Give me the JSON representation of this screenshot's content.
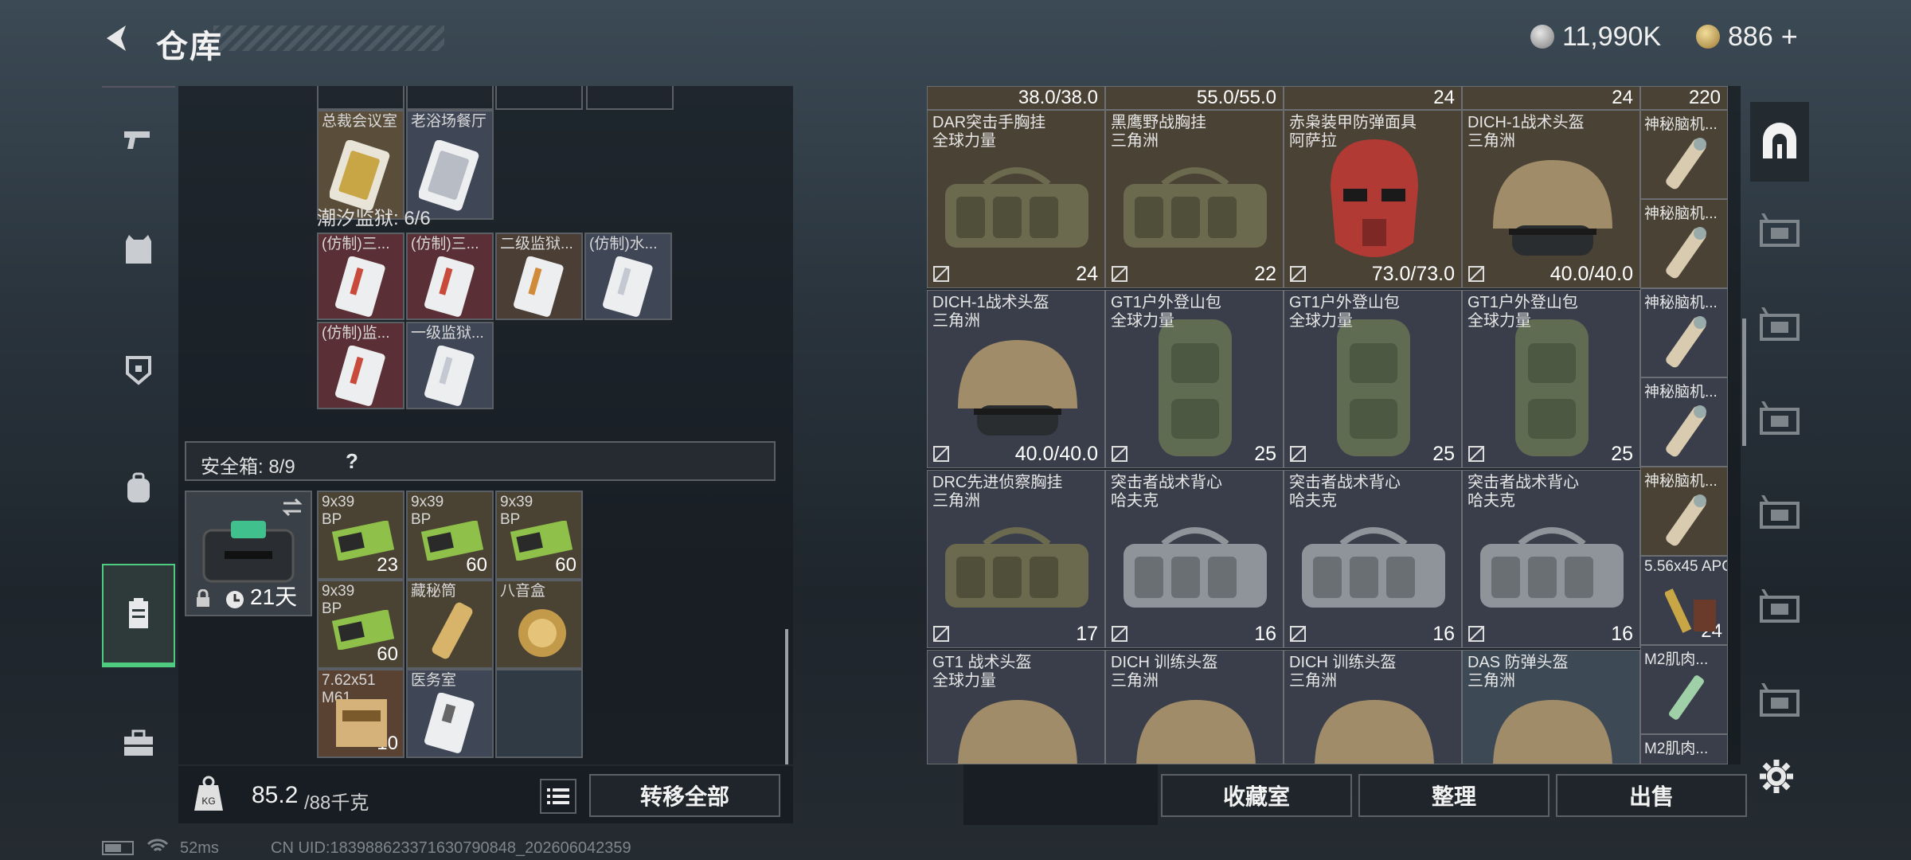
{
  "header": {
    "title": "仓库"
  },
  "currency": [
    {
      "icon": "silver-coin-icon",
      "value": "11,990K"
    },
    {
      "icon": "gold-coin-icon",
      "value": "886"
    }
  ],
  "add_label": "+",
  "rail_tabs": [
    "pistol-icon",
    "vest-icon",
    "backpack-icon",
    "bag-icon",
    "container-icon",
    "briefcase-icon"
  ],
  "left": {
    "top_partial_row": [
      {
        "name": "总裁会议室",
        "tone": "#5a4e3a"
      },
      {
        "name": "老浴场餐厅",
        "tone": "#3f4656"
      }
    ],
    "prison": {
      "label": "潮汐监狱: 6/6",
      "items": [
        {
          "name": "(仿制)三...",
          "tone": "#5a3036"
        },
        {
          "name": "(仿制)三...",
          "tone": "#5a3036"
        },
        {
          "name": "二级监狱...",
          "tone": "#4a3e35"
        },
        {
          "name": "(仿制)水...",
          "tone": "#3f4656"
        },
        {
          "name": "(仿制)监...",
          "tone": "#5a3036"
        },
        {
          "name": "一级监狱...",
          "tone": "#3f4656"
        }
      ]
    },
    "safe_box": {
      "label": "安全箱: 8/9",
      "help": "?",
      "days": "21天",
      "items": [
        {
          "name": "9x39 BP",
          "count": "23",
          "tone": "#4a4232"
        },
        {
          "name": "9x39 BP",
          "count": "60",
          "tone": "#4a4232"
        },
        {
          "name": "9x39 BP",
          "count": "60",
          "tone": "#4a4232"
        },
        {
          "name": "9x39 BP",
          "count": "60",
          "tone": "#4a4232"
        },
        {
          "name": "藏秘筒",
          "count": "",
          "tone": "#4a4232"
        },
        {
          "name": "八音盒",
          "count": "",
          "tone": "#4a4232"
        },
        {
          "name": "7.62x51 M61",
          "count": "10",
          "tone": "#5a4232"
        },
        {
          "name": "医务室",
          "count": "",
          "tone": "#3f4656"
        },
        {
          "name": "",
          "count": "",
          "tone": "#2f3a44"
        }
      ]
    },
    "weight": {
      "current": "85.2",
      "max": "/88千克"
    },
    "transfer_all": "转移全部"
  },
  "grid": {
    "top_partial": [
      "38.0/38.0",
      "55.0/55.0",
      "24",
      "24",
      "220"
    ],
    "cells": [
      {
        "name": "DAR突击手胸挂",
        "src": "全球力量",
        "val": "24",
        "type": "rig",
        "tone": "#4a4234"
      },
      {
        "name": "黑鹰野战胸挂",
        "src": "三角洲",
        "val": "22",
        "type": "rig",
        "tone": "#4a4234"
      },
      {
        "name": "赤枭装甲防弹面具",
        "src": "阿萨拉",
        "val": "73.0/73.0",
        "type": "mask",
        "tone": "#4a4234"
      },
      {
        "name": "DICH-1战术头盔",
        "src": "三角洲",
        "val": "40.0/40.0",
        "type": "helmet",
        "tone": "#4a4234"
      },
      {
        "name": "DICH-1战术头盔",
        "src": "三角洲",
        "val": "40.0/40.0",
        "type": "helmet",
        "tone": "#3a3e4a"
      },
      {
        "name": "GT1户外登山包",
        "src": "全球力量",
        "val": "25",
        "type": "pack",
        "tone": "#3a3e4a"
      },
      {
        "name": "GT1户外登山包",
        "src": "全球力量",
        "val": "25",
        "type": "pack",
        "tone": "#3a3e4a"
      },
      {
        "name": "GT1户外登山包",
        "src": "全球力量",
        "val": "25",
        "type": "pack",
        "tone": "#3a3e4a"
      },
      {
        "name": "DRC先进侦察胸挂",
        "src": "三角洲",
        "val": "17",
        "type": "rig",
        "tone": "#3a3e4a"
      },
      {
        "name": "突击者战术背心",
        "src": "哈夫克",
        "val": "16",
        "type": "rigg",
        "tone": "#3a3e4a"
      },
      {
        "name": "突击者战术背心",
        "src": "哈夫克",
        "val": "16",
        "type": "rigg",
        "tone": "#3a3e4a"
      },
      {
        "name": "突击者战术背心",
        "src": "哈夫克",
        "val": "16",
        "type": "rigg",
        "tone": "#3a3e4a"
      },
      {
        "name": "GT1 战术头盔",
        "src": "全球力量",
        "val": "",
        "type": "helmet",
        "tone": "#3a3e4a"
      },
      {
        "name": "DICH 训练头盔",
        "src": "三角洲",
        "val": "",
        "type": "helmet",
        "tone": "#3a3e4a"
      },
      {
        "name": "DICH 训练头盔",
        "src": "三角洲",
        "val": "",
        "type": "helmet",
        "tone": "#3a3e4a"
      },
      {
        "name": "DAS 防弹头盔",
        "src": "三角洲",
        "val": "",
        "type": "helmet",
        "tone": "#3d4a56"
      }
    ],
    "side_column": [
      {
        "name": "神秘脑机...",
        "tone": "#4a4234"
      },
      {
        "name": "神秘脑机...",
        "tone": "#4a4234"
      },
      {
        "name": "神秘脑机...",
        "tone": "#3a3e4a"
      },
      {
        "name": "神秘脑机...",
        "tone": "#3a3e4a"
      },
      {
        "name": "神秘脑机...",
        "tone": "#4a4234"
      },
      {
        "name": "5.56x45 APC",
        "tone": "#3a3e4a",
        "count": "24"
      },
      {
        "name": "M2肌肉...",
        "tone": "#3a3e4a"
      },
      {
        "name": "M2肌肉...",
        "tone": "#3a3e4a"
      }
    ]
  },
  "bottom_buttons": [
    "收藏室",
    "整理",
    "出售"
  ],
  "right_rail": [
    "arch-icon",
    "v-card-icon",
    "v-card-icon",
    "gti-card-icon",
    "iv-card-icon",
    "iv-plus-card-icon",
    "iv-card-icon"
  ],
  "status_bar": {
    "ping": "52ms",
    "uid": "CN UID:18398862337163079084​8_202606042359"
  }
}
